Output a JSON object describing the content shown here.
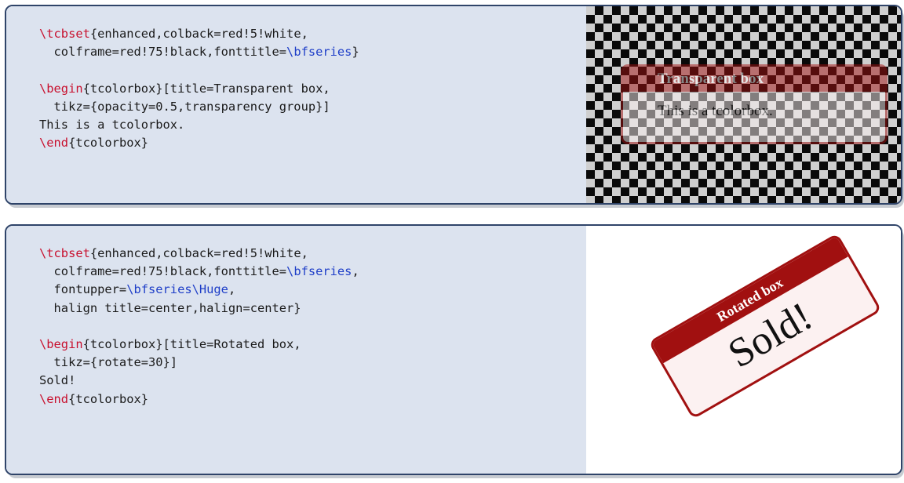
{
  "examples": [
    {
      "code": [
        [
          {
            "k": "kw",
            "t": "\\tcbset"
          },
          {
            "k": "",
            "t": "{enhanced,colback=red!5!white,"
          }
        ],
        [
          {
            "k": "",
            "t": "  colframe=red!75!black,fonttitle="
          },
          {
            "k": "cs",
            "t": "\\bfseries"
          },
          {
            "k": "",
            "t": "}"
          }
        ],
        [],
        [
          {
            "k": "kw",
            "t": "\\begin"
          },
          {
            "k": "",
            "t": "{tcolorbox}[title=Transparent box,"
          }
        ],
        [
          {
            "k": "",
            "t": "  tikz={opacity=0.5,transparency group}]"
          }
        ],
        [
          {
            "k": "",
            "t": "This is a tcolorbox."
          }
        ],
        [
          {
            "k": "kw",
            "t": "\\end"
          },
          {
            "k": "",
            "t": "{tcolorbox}"
          }
        ]
      ],
      "result": {
        "title": "Transparent box",
        "body": "This is a tcolorbox."
      }
    },
    {
      "code": [
        [
          {
            "k": "kw",
            "t": "\\tcbset"
          },
          {
            "k": "",
            "t": "{enhanced,colback=red!5!white,"
          }
        ],
        [
          {
            "k": "",
            "t": "  colframe=red!75!black,fonttitle="
          },
          {
            "k": "cs",
            "t": "\\bfseries"
          },
          {
            "k": "",
            "t": ","
          }
        ],
        [
          {
            "k": "",
            "t": "  fontupper="
          },
          {
            "k": "cs",
            "t": "\\bfseries\\Huge"
          },
          {
            "k": "",
            "t": ","
          }
        ],
        [
          {
            "k": "",
            "t": "  halign title=center,halign=center}"
          }
        ],
        [],
        [
          {
            "k": "kw",
            "t": "\\begin"
          },
          {
            "k": "",
            "t": "{tcolorbox}[title=Rotated box,"
          }
        ],
        [
          {
            "k": "",
            "t": "  tikz={rotate=30}]"
          }
        ],
        [
          {
            "k": "",
            "t": "Sold!"
          }
        ],
        [
          {
            "k": "kw",
            "t": "\\end"
          },
          {
            "k": "",
            "t": "{tcolorbox}"
          }
        ]
      ],
      "result": {
        "title": "Rotated box",
        "body": "Sold!",
        "rotation_deg": 30
      }
    }
  ],
  "colors": {
    "frame": "#2f4469",
    "code_bg": "#dce3ef",
    "box_frame": "#a11010",
    "keyword": "#c8102e",
    "control_seq": "#1f3fc8"
  }
}
